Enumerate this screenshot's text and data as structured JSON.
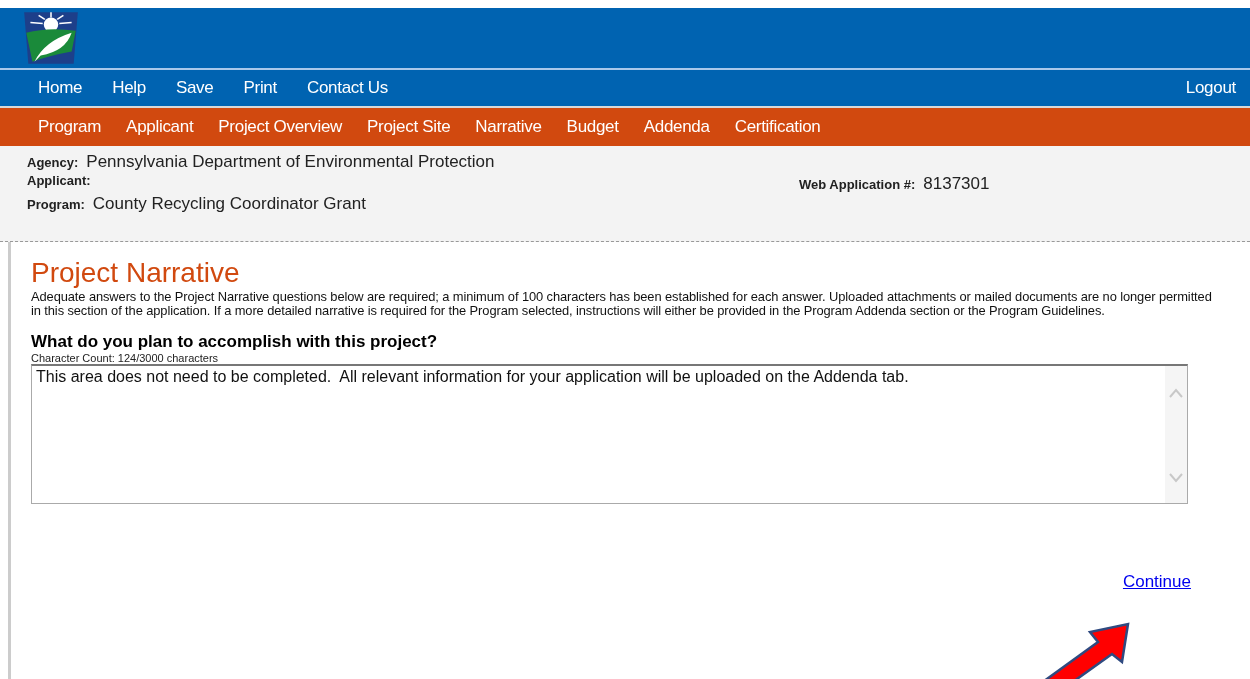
{
  "top_nav": [
    {
      "label": "Home"
    },
    {
      "label": "Help"
    },
    {
      "label": "Save"
    },
    {
      "label": "Print"
    },
    {
      "label": "Contact Us"
    }
  ],
  "logout": "Logout",
  "section_tabs": [
    {
      "label": "Program"
    },
    {
      "label": "Applicant"
    },
    {
      "label": "Project Overview"
    },
    {
      "label": "Project Site"
    },
    {
      "label": "Narrative"
    },
    {
      "label": "Budget"
    },
    {
      "label": "Addenda"
    },
    {
      "label": "Certification"
    }
  ],
  "info": {
    "agency_label": "Agency:",
    "agency": "Pennsylvania Department of Environmental Protection",
    "applicant_label": "Applicant:",
    "program_label": "Program:",
    "program": "County Recycling Coordinator Grant",
    "web_app_label": "Web Application #:",
    "web_app": "8137301"
  },
  "page_title": "Project Narrative",
  "intro": "Adequate answers to the Project Narrative questions below are required; a minimum of 100 characters has been established for each answer.  Uploaded attachments or mailed documents are no longer permitted in this section of the application.  If a more detailed narrative is required for the Program selected, instructions will either be provided in the Program Addenda section or the Program Guidelines.",
  "question": "What do you plan to accomplish with this project?",
  "char_count": "Character Count: 124/3000 characters",
  "answer": "This area does not need to be completed.  All relevant information for your application will be uploaded on the Addenda tab.",
  "continue": "Continue"
}
